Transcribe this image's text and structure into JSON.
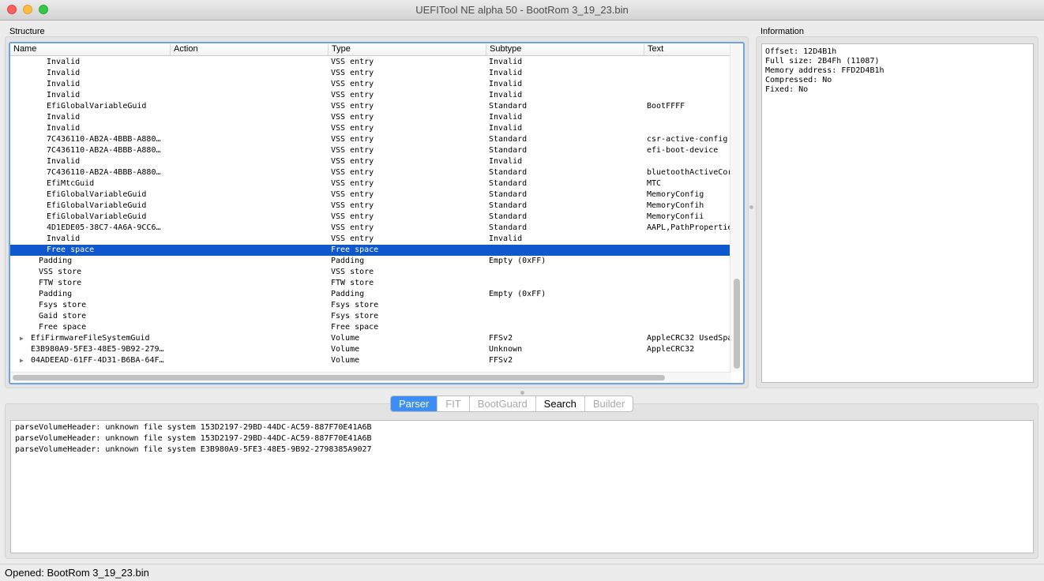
{
  "window": {
    "title": "UEFITool NE alpha 50 - BootRom 3_19_23.bin"
  },
  "structure": {
    "label": "Structure",
    "columns": [
      "Name",
      "Action",
      "Type",
      "Subtype",
      "Text"
    ],
    "rows": [
      {
        "name": "Invalid",
        "indent": 2,
        "type": "VSS entry",
        "subtype": "Invalid",
        "text": ""
      },
      {
        "name": "Invalid",
        "indent": 2,
        "type": "VSS entry",
        "subtype": "Invalid",
        "text": ""
      },
      {
        "name": "Invalid",
        "indent": 2,
        "type": "VSS entry",
        "subtype": "Invalid",
        "text": ""
      },
      {
        "name": "Invalid",
        "indent": 2,
        "type": "VSS entry",
        "subtype": "Invalid",
        "text": ""
      },
      {
        "name": "EfiGlobalVariableGuid",
        "indent": 2,
        "type": "VSS entry",
        "subtype": "Standard",
        "text": "BootFFFF"
      },
      {
        "name": "Invalid",
        "indent": 2,
        "type": "VSS entry",
        "subtype": "Invalid",
        "text": ""
      },
      {
        "name": "Invalid",
        "indent": 2,
        "type": "VSS entry",
        "subtype": "Invalid",
        "text": ""
      },
      {
        "name": "7C436110-AB2A-4BBB-A880…",
        "indent": 2,
        "type": "VSS entry",
        "subtype": "Standard",
        "text": "csr-active-config"
      },
      {
        "name": "7C436110-AB2A-4BBB-A880…",
        "indent": 2,
        "type": "VSS entry",
        "subtype": "Standard",
        "text": "efi-boot-device"
      },
      {
        "name": "Invalid",
        "indent": 2,
        "type": "VSS entry",
        "subtype": "Invalid",
        "text": ""
      },
      {
        "name": "7C436110-AB2A-4BBB-A880…",
        "indent": 2,
        "type": "VSS entry",
        "subtype": "Standard",
        "text": "bluetoothActiveCor"
      },
      {
        "name": "EfiMtcGuid",
        "indent": 2,
        "type": "VSS entry",
        "subtype": "Standard",
        "text": "MTC"
      },
      {
        "name": "EfiGlobalVariableGuid",
        "indent": 2,
        "type": "VSS entry",
        "subtype": "Standard",
        "text": "MemoryConfig"
      },
      {
        "name": "EfiGlobalVariableGuid",
        "indent": 2,
        "type": "VSS entry",
        "subtype": "Standard",
        "text": "MemoryConfih"
      },
      {
        "name": "EfiGlobalVariableGuid",
        "indent": 2,
        "type": "VSS entry",
        "subtype": "Standard",
        "text": "MemoryConfii"
      },
      {
        "name": "4D1EDE05-38C7-4A6A-9CC6…",
        "indent": 2,
        "type": "VSS entry",
        "subtype": "Standard",
        "text": "AAPL,PathPropertie"
      },
      {
        "name": "Invalid",
        "indent": 2,
        "type": "VSS entry",
        "subtype": "Invalid",
        "text": ""
      },
      {
        "name": "Free space",
        "indent": 2,
        "type": "Free space",
        "subtype": "",
        "text": "",
        "selected": true
      },
      {
        "name": "Padding",
        "indent": 1,
        "type": "Padding",
        "subtype": "Empty (0xFF)",
        "text": ""
      },
      {
        "name": "VSS store",
        "indent": 1,
        "type": "VSS store",
        "subtype": "",
        "text": ""
      },
      {
        "name": "FTW store",
        "indent": 1,
        "type": "FTW store",
        "subtype": "",
        "text": ""
      },
      {
        "name": "Padding",
        "indent": 1,
        "type": "Padding",
        "subtype": "Empty (0xFF)",
        "text": ""
      },
      {
        "name": "Fsys store",
        "indent": 1,
        "type": "Fsys store",
        "subtype": "",
        "text": ""
      },
      {
        "name": "Gaid store",
        "indent": 1,
        "type": "Fsys store",
        "subtype": "",
        "text": ""
      },
      {
        "name": "Free space",
        "indent": 1,
        "type": "Free space",
        "subtype": "",
        "text": ""
      },
      {
        "name": "EfiFirmwareFileSystemGuid",
        "indent": 0,
        "expandable": true,
        "type": "Volume",
        "subtype": "FFSv2",
        "text": "AppleCRC32 UsedSpa"
      },
      {
        "name": "E3B980A9-5FE3-48E5-9B92-279…",
        "indent": 0,
        "type": "Volume",
        "subtype": "Unknown",
        "text": "AppleCRC32"
      },
      {
        "name": "04ADEEAD-61FF-4D31-B6BA-64F…",
        "indent": 0,
        "expandable": true,
        "type": "Volume",
        "subtype": "FFSv2",
        "text": ""
      }
    ]
  },
  "information": {
    "label": "Information",
    "lines": [
      "Offset: 12D4B1h",
      "Full size: 2B4Fh (11087)",
      "Memory address: FFD2D4B1h",
      "Compressed: No",
      "Fixed: No"
    ]
  },
  "tabs": [
    {
      "label": "Parser",
      "state": "active"
    },
    {
      "label": "FIT",
      "state": "disabled"
    },
    {
      "label": "BootGuard",
      "state": "disabled"
    },
    {
      "label": "Search",
      "state": "normal"
    },
    {
      "label": "Builder",
      "state": "disabled"
    }
  ],
  "log": {
    "lines": [
      "parseVolumeHeader: unknown file system 153D2197-29BD-44DC-AC59-887F70E41A6B",
      "parseVolumeHeader: unknown file system 153D2197-29BD-44DC-AC59-887F70E41A6B",
      "parseVolumeHeader: unknown file system E3B980A9-5FE3-48E5-9B92-2798385A9027"
    ]
  },
  "status": {
    "text": "Opened: BootRom 3_19_23.bin"
  }
}
